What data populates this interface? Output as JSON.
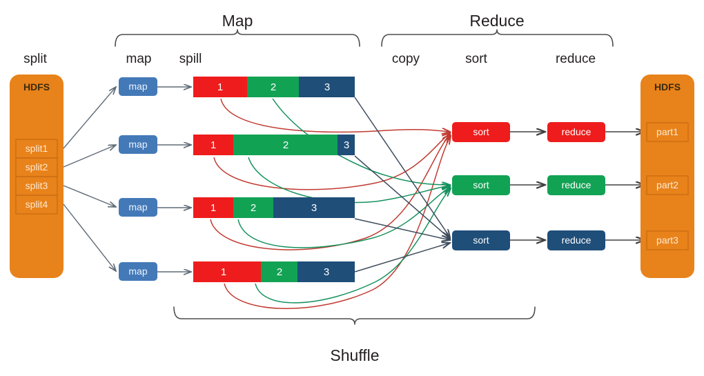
{
  "diagram": {
    "title_labels": {
      "map_stage": "Map",
      "reduce_stage": "Reduce",
      "shuffle_stage": "Shuffle"
    },
    "column_labels": {
      "split": "split",
      "map": "map",
      "spill": "spill",
      "copy": "copy",
      "sort": "sort",
      "reduce": "reduce"
    },
    "input_store": {
      "name": "HDFS",
      "splits": [
        "split1",
        "split2",
        "split3",
        "split4"
      ]
    },
    "output_store": {
      "name": "HDFS",
      "parts": [
        "part1",
        "part2",
        "part3"
      ]
    },
    "mappers": [
      {
        "label": "map"
      },
      {
        "label": "map"
      },
      {
        "label": "map"
      },
      {
        "label": "map"
      }
    ],
    "spill_bars": [
      {
        "segments": [
          {
            "label": "1",
            "color": "#ee1c1c",
            "width_pct": 33.3
          },
          {
            "label": "2",
            "color": "#12a254",
            "width_pct": 32.1
          },
          {
            "label": "3",
            "color": "#1f4e79",
            "width_pct": 34.6
          }
        ]
      },
      {
        "segments": [
          {
            "label": "1",
            "color": "#ee1c1c",
            "width_pct": 25.0
          },
          {
            "label": "2",
            "color": "#12a254",
            "width_pct": 64.6
          },
          {
            "label": "3",
            "color": "#1f4e79",
            "width_pct": 10.4
          }
        ]
      },
      {
        "segments": [
          {
            "label": "1",
            "color": "#ee1c1c",
            "width_pct": 25.0
          },
          {
            "label": "2",
            "color": "#12a254",
            "width_pct": 25.0
          },
          {
            "label": "3",
            "color": "#1f4e79",
            "width_pct": 50.0
          }
        ]
      },
      {
        "segments": [
          {
            "label": "1",
            "color": "#ee1c1c",
            "width_pct": 41.7
          },
          {
            "label": "2",
            "color": "#12a254",
            "width_pct": 22.9
          },
          {
            "label": "3",
            "color": "#1f4e79",
            "width_pct": 35.4
          }
        ]
      }
    ],
    "sorters": [
      {
        "label": "sort",
        "color": "#ee1c1c"
      },
      {
        "label": "sort",
        "color": "#12a254"
      },
      {
        "label": "sort",
        "color": "#1f4e79"
      }
    ],
    "reducers": [
      {
        "label": "reduce",
        "color": "#ee1c1c"
      },
      {
        "label": "reduce",
        "color": "#12a254"
      },
      {
        "label": "reduce",
        "color": "#1f4e79"
      }
    ],
    "colors": {
      "hdfs_orange": "#e8821a",
      "hdfs_border": "#c96c12",
      "map_blue": "#4479b8",
      "partition_1_red": "#ee1c1c",
      "partition_2_green": "#12a254",
      "partition_3_blue": "#1f4e79",
      "bracket_gray": "#4d4d4d",
      "text_dark": "#231f20",
      "background": "#ffffff"
    }
  }
}
